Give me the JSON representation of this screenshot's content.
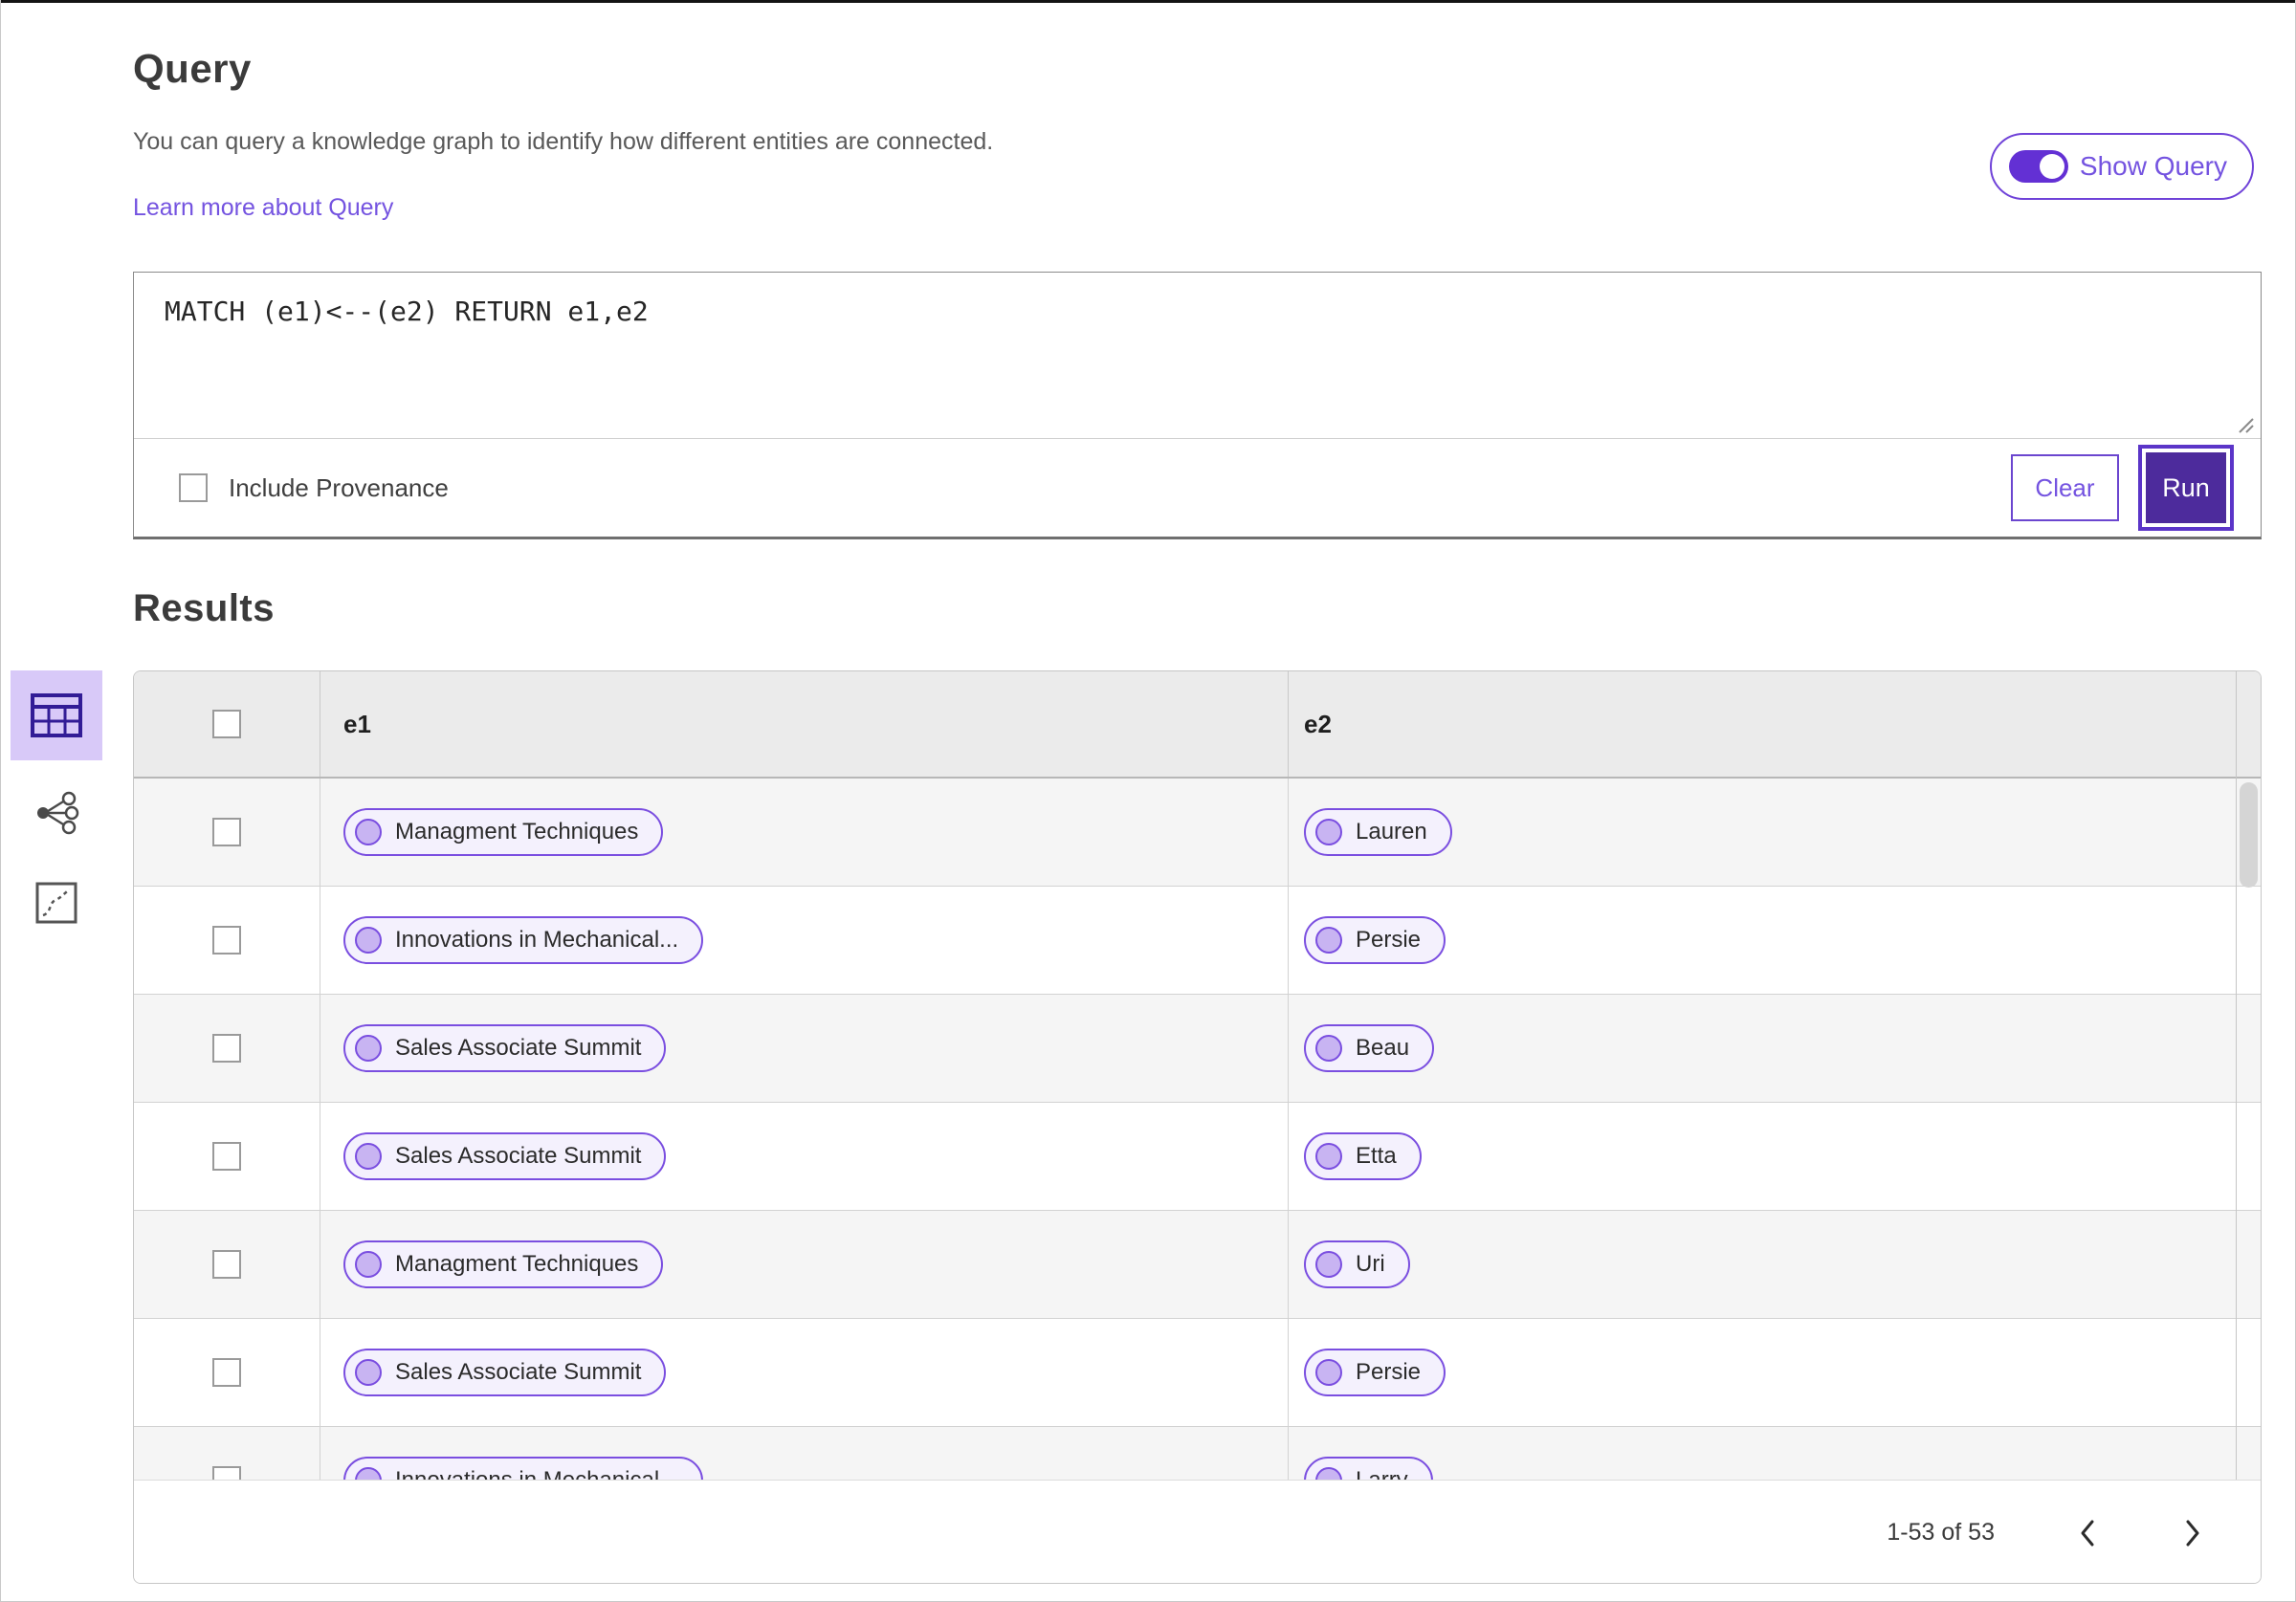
{
  "query_section": {
    "title": "Query",
    "description": "You can query a knowledge graph to identify how different entities are connected.",
    "learn_more_label": "Learn more about Query",
    "show_query_label": "Show Query",
    "show_query_toggle_state": "on",
    "query_text": "MATCH (e1)<--(e2) RETURN e1,e2",
    "include_provenance_label": "Include Provenance",
    "include_provenance_checked": false,
    "clear_label": "Clear",
    "run_label": "Run"
  },
  "results_section": {
    "title": "Results",
    "view_switcher": {
      "selected": "table-view",
      "items": [
        {
          "name": "table-view"
        },
        {
          "name": "network-view"
        },
        {
          "name": "chart-view"
        }
      ]
    },
    "table": {
      "columns": [
        "e1",
        "e2"
      ],
      "select_all_checked": false,
      "rows": [
        {
          "e1": "Managment Techniques",
          "e2": "Lauren"
        },
        {
          "e1": "Innovations in Mechanical...",
          "e2": "Persie"
        },
        {
          "e1": "Sales Associate Summit",
          "e2": "Beau"
        },
        {
          "e1": "Sales Associate Summit",
          "e2": "Etta"
        },
        {
          "e1": "Managment Techniques",
          "e2": "Uri"
        },
        {
          "e1": "Sales Associate Summit",
          "e2": "Persie"
        },
        {
          "e1": "Innovations in Mechanical...",
          "e2": "Larry"
        }
      ]
    },
    "pagination": {
      "range_label": "1-53 of 53"
    }
  },
  "colors": {
    "accent_purple": "#6f42d8",
    "accent_text": "#7453e0",
    "run_button_fill": "#4d2b9c",
    "toggle_fill": "#6330d4",
    "pill_border": "#7a4ee0",
    "pill_background": "#f4f1fd",
    "pill_circle_fill": "#c8b4f2",
    "selected_view_background": "#d8c9f8",
    "header_background": "#ebebeb",
    "odd_row_background": "#f5f5f5"
  }
}
